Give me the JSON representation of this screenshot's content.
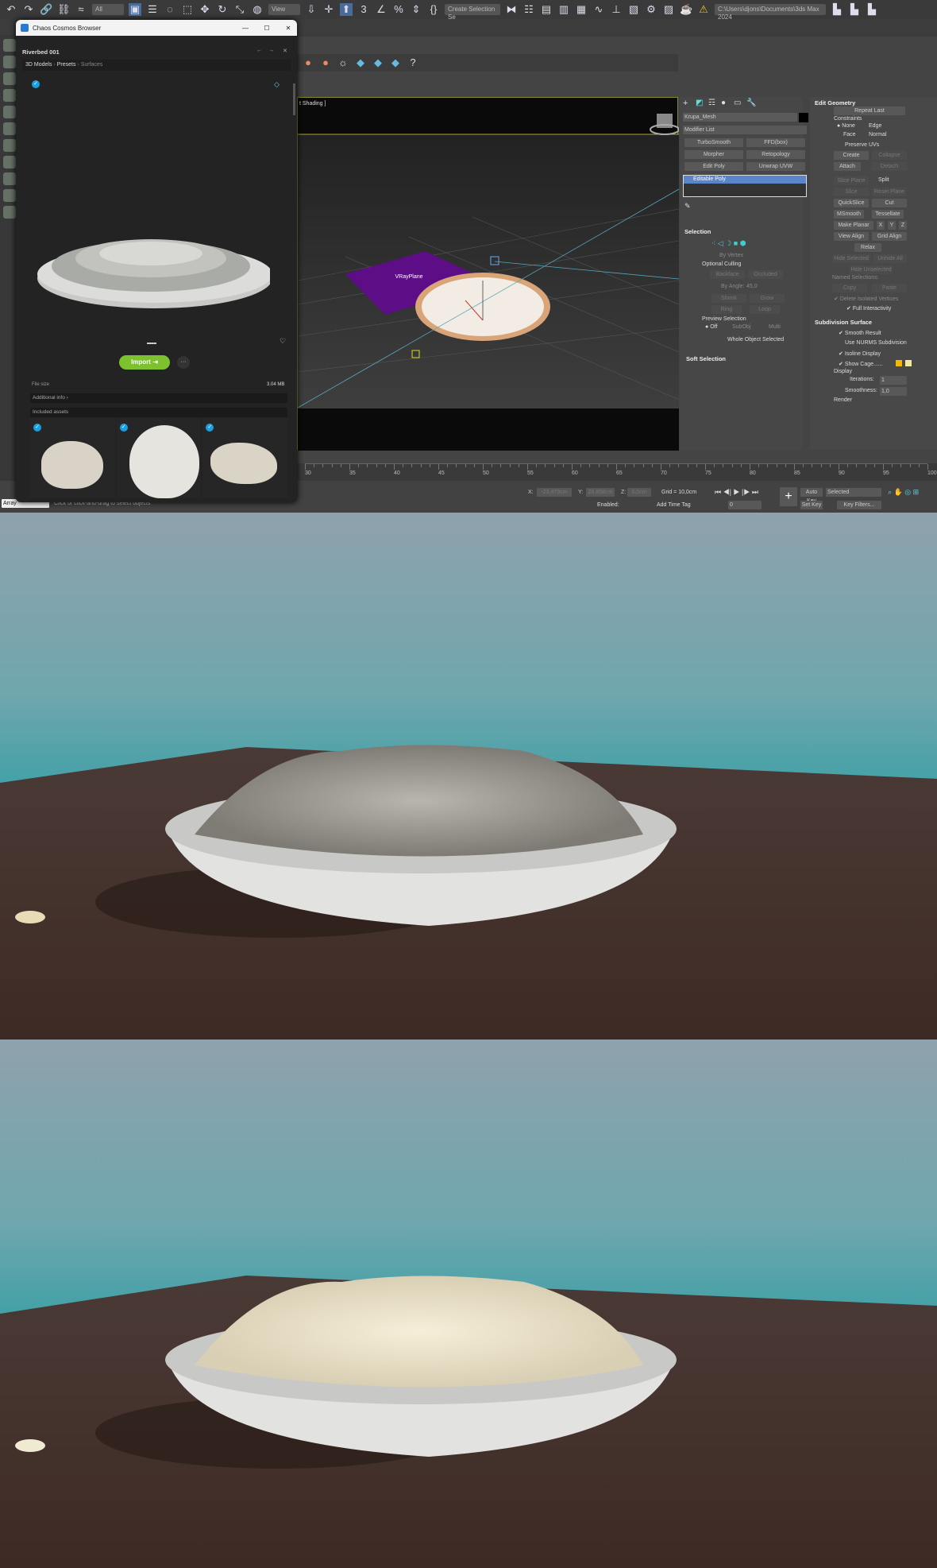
{
  "toolbar": {
    "filter_all": "All",
    "ref_coord": "View",
    "selection_set": "Create Selection Se",
    "project_path": "C:\\Users\\djons\\Documents\\3ds Max 2024"
  },
  "cosmos": {
    "window_title": "Chaos Cosmos Browser",
    "asset_title": "Riverbed 001",
    "breadcrumb": [
      "3D Models",
      "Presets",
      "Surfaces"
    ],
    "import_label": "Import",
    "more_label": "···",
    "file_size_label": "File size",
    "file_size": "3.04 MB",
    "additional_info": "Additional info",
    "included_assets": "Included assets"
  },
  "viewport": {
    "label": "t Shading ]",
    "plane_label": "VRayPlane"
  },
  "command_panel": {
    "object_name": "Krupa_Mesh",
    "modifier_list": "Modifier List",
    "modifier_buttons": [
      "TurboSmooth",
      "FFD(box)",
      "Morpher",
      "Retopology",
      "Edit Poly",
      "Unwrap UVW"
    ],
    "stack_item": "Editable Poly",
    "selection": {
      "title": "Selection",
      "by_vertex": "By Vertex",
      "optional_culling": "Optional Culling",
      "backface": "Backface",
      "occluded": "Occluded",
      "by_angle": "By Angle:",
      "angle_value": "45,0",
      "shrink": "Shrink",
      "grow": "Grow",
      "ring": "Ring",
      "loop": "Loop",
      "preview_selection": "Preview Selection",
      "off": "Off",
      "subobj": "SubObj",
      "multi": "Multi",
      "status": "Whole Object Selected"
    },
    "soft_selection": "Soft Selection",
    "edit_geometry": {
      "title": "Edit Geometry",
      "repeat_last": "Repeat Last",
      "constraints": "Constraints",
      "none": "None",
      "edge": "Edge",
      "face": "Face",
      "normal": "Normal",
      "preserve_uvs": "Preserve UVs",
      "create": "Create",
      "collapse": "Collapse",
      "attach": "Attach",
      "detach": "Detach",
      "slice_plane": "Slice Plane",
      "split": "Split",
      "slice": "Slice",
      "reset_plane": "Reset Plane",
      "quickslice": "QuickSlice",
      "cut": "Cut",
      "msmooth": "MSmooth",
      "tessellate": "Tessellate",
      "make_planar": "Make Planar",
      "x": "X",
      "y": "Y",
      "z": "Z",
      "view_align": "View Align",
      "grid_align": "Grid Align",
      "relax": "Relax",
      "hide_selected": "Hide Selected",
      "unhide_all": "Unhide All",
      "hide_unselected": "Hide Unselected",
      "named_selections": "Named Selections:",
      "copy": "Copy",
      "paste": "Paste",
      "delete_isolated": "Delete Isolated Vertices",
      "full_interactivity": "Full Interactivity"
    },
    "subdivision": {
      "title": "Subdivision Surface",
      "smooth_result": "Smooth Result",
      "use_nurms": "Use NURMS Subdivision",
      "isoline": "Isoline Display",
      "show_cage": "Show Cage......",
      "display": "Display",
      "iterations_label": "Iterations:",
      "iterations": "1",
      "smoothness_label": "Smoothness:",
      "smoothness": "1,0",
      "render": "Render"
    }
  },
  "timeline": {
    "ticks": [
      "30",
      "35",
      "40",
      "45",
      "50",
      "55",
      "60",
      "65",
      "70",
      "75",
      "80",
      "85",
      "90",
      "95",
      "100"
    ]
  },
  "status": {
    "script_label": "Array",
    "prompt": "Click or click-and-drag to select objects",
    "x": "-23,479cm",
    "y": "26,858cm",
    "z": "0,0cm",
    "grid": "Grid = 10,0cm",
    "enabled": "Enabled:",
    "add_time_tag": "Add Time Tag",
    "frame": "0",
    "auto_key": "Auto Key",
    "selected": "Selected",
    "set_key": "Set Key",
    "key_filters": "Key Filters..."
  }
}
